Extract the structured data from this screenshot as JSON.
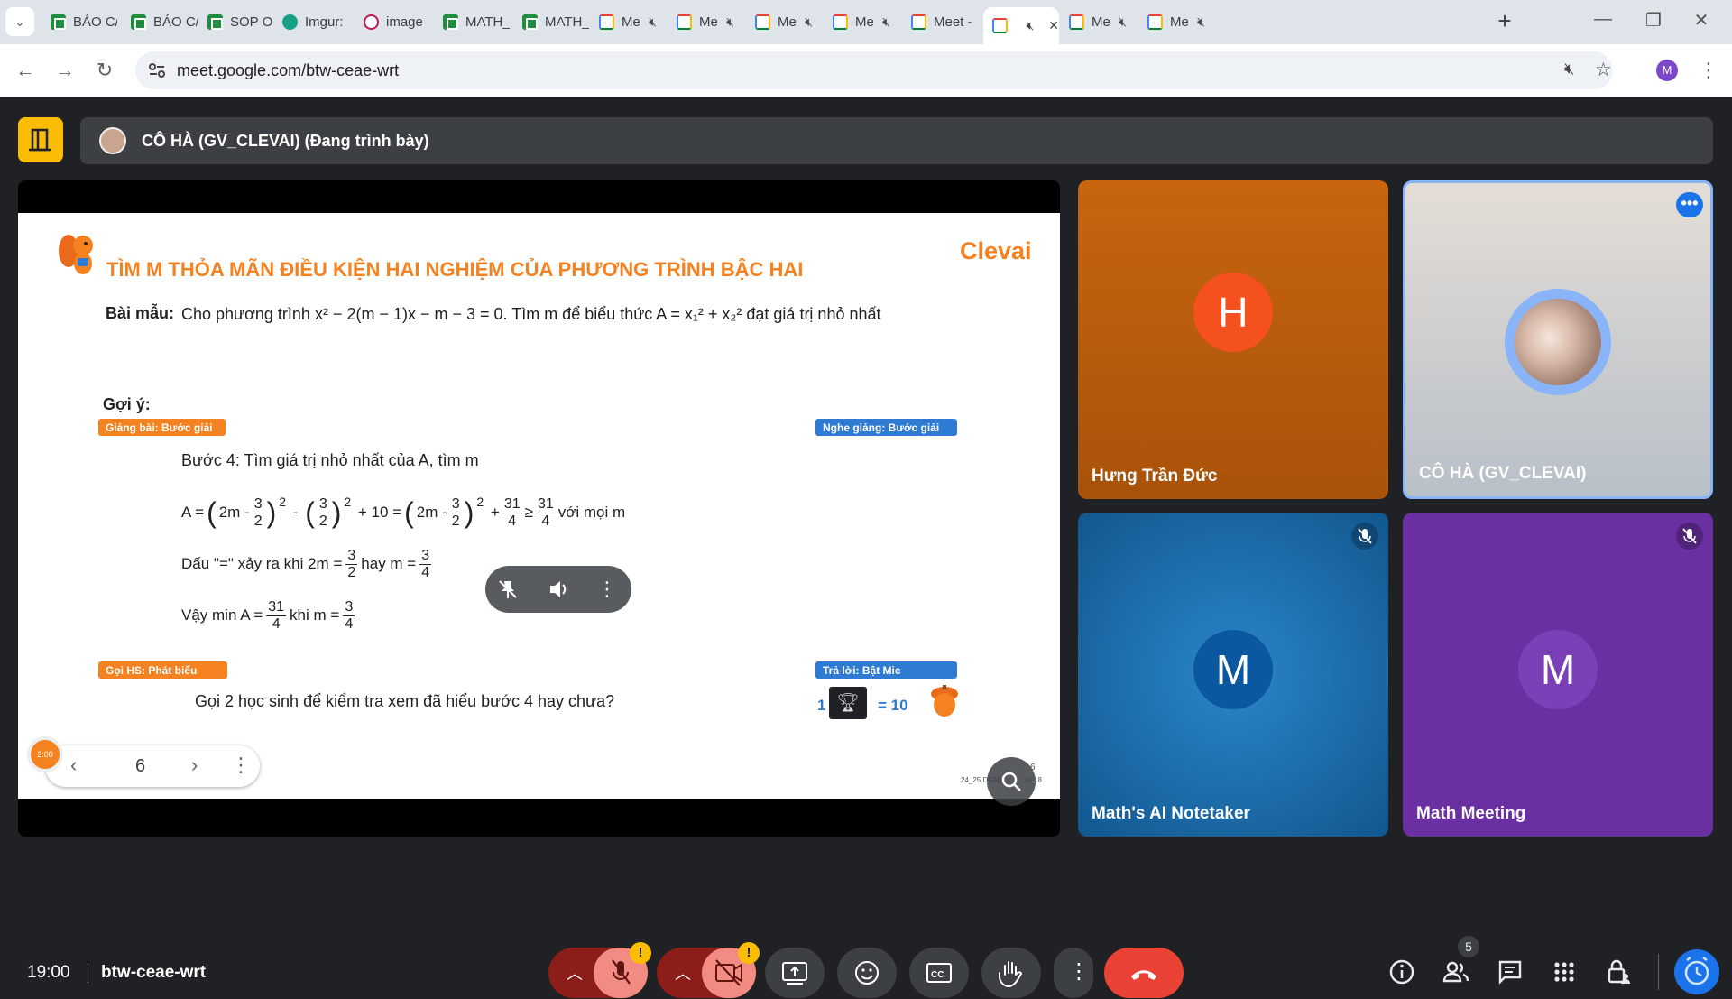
{
  "browser": {
    "tabs": [
      {
        "title": "BÁO C/",
        "type": "sheet"
      },
      {
        "title": "BÁO C/",
        "type": "sheet"
      },
      {
        "title": "SOP O",
        "type": "sheet"
      },
      {
        "title": "Imgur:",
        "type": "imgur"
      },
      {
        "title": "image",
        "type": "image"
      },
      {
        "title": "MATH_",
        "type": "sheet"
      },
      {
        "title": "MATH_",
        "type": "sheet"
      },
      {
        "title": "Me",
        "type": "meet",
        "muted": true
      },
      {
        "title": "Me",
        "type": "meet",
        "muted": true
      },
      {
        "title": "Me",
        "type": "meet",
        "muted": true
      },
      {
        "title": "Me",
        "type": "meet",
        "muted": true
      },
      {
        "title": "Meet -",
        "type": "meet",
        "muted": false
      },
      {
        "title": "",
        "type": "meet",
        "muted": true,
        "active": true
      },
      {
        "title": "Me",
        "type": "meet",
        "muted": true
      },
      {
        "title": "Me",
        "type": "meet",
        "muted": true
      }
    ],
    "url": "meet.google.com/btw-ceae-wrt",
    "profile_initial": "M"
  },
  "meet": {
    "presenter_label": "CÔ HÀ (GV_CLEVAI) (Đang trình bày)",
    "slide": {
      "title": "TÌM M THỎA MÃN ĐIỀU KIỆN HAI NGHIỆM CỦA PHƯƠNG TRÌNH BẬC HAI",
      "brand": "Clevai",
      "example_label": "Bài mẫu:",
      "example_text": "Cho phương trình x² − 2(m − 1)x − m − 3 = 0. Tìm m để biểu thức A = x₁² + x₂² đạt giá trị nhỏ nhất",
      "hint_label": "Gợi ý:",
      "tag_lecture": "Giảng bài: Bước giải",
      "tag_listen": "Nghe giảng: Bước giải",
      "step": "Bước 4: Tìm giá trị nhỏ nhất của A, tìm m",
      "tag_call": "Gọi HS: Phát biểu",
      "tag_answer": "Trả lời: Bật Mic",
      "question": "Gọi 2 học sinh để kiểm tra xem đã hiểu bước 4 hay chưa?",
      "reward_count": "1",
      "reward_value": "= 10",
      "footer_code": "24_25.DGN",
      "footer_page": "6",
      "footer_range": "to 18",
      "line_equality_prefix": "Dấu \"=\" xảy ra khi 2m =",
      "line_equality_mid": "hay m =",
      "line_min_prefix": "Vậy min A =",
      "line_min_mid": "khi m =",
      "line_a_tail": "với mọi m"
    },
    "pager": {
      "page": "6"
    },
    "timer": "2:00",
    "participants": [
      {
        "name": "Hưng Trần Đức",
        "initial": "H",
        "bg": "#c8650e",
        "avatar_bg": "#f4511e",
        "muted": false
      },
      {
        "name": "CÔ HÀ (GV_CLEVAI)",
        "initial": "",
        "bg": "#d9d4cf",
        "avatar_bg": "#8ab4f8",
        "muted": false,
        "speaking": true
      },
      {
        "name": "Math's AI Notetaker",
        "initial": "M",
        "bg": "#1a6fb0",
        "avatar_bg": "#0b57a0",
        "muted": true
      },
      {
        "name": "Math Meeting",
        "initial": "M",
        "bg": "#6a2fa0",
        "avatar_bg": "#7b3fb8",
        "muted": true
      }
    ],
    "bottom": {
      "time": "19:00",
      "code": "btw-ceae-wrt",
      "people_count": "5",
      "warning": "!"
    }
  }
}
